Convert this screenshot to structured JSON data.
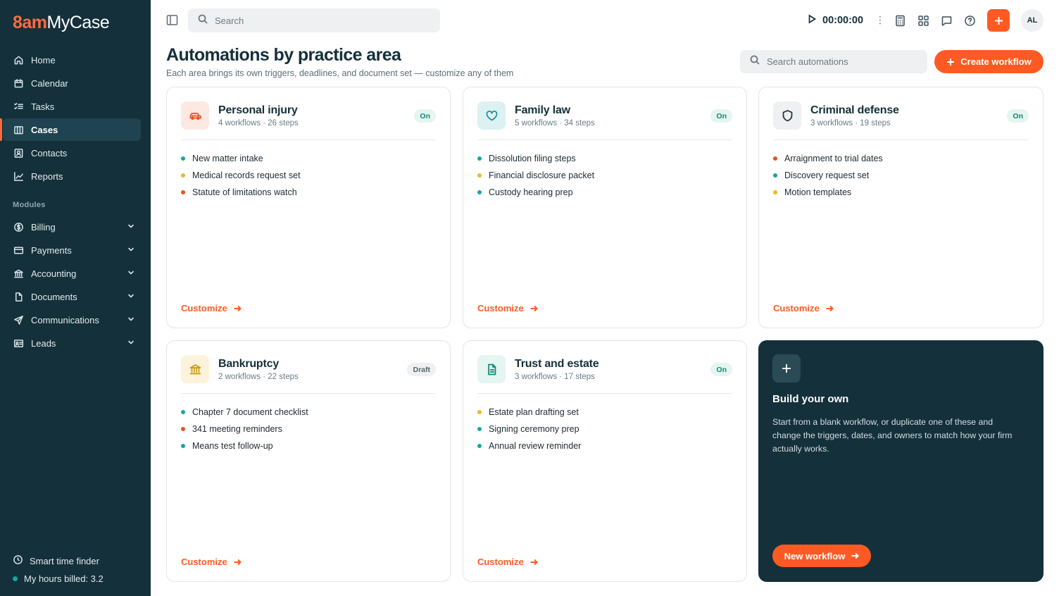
{
  "colors": {
    "accent": "#ff5a23",
    "sidebar": "#14303a",
    "teal": "#1ba3a3",
    "yellow": "#e8b92c",
    "red": "#e2542b"
  },
  "sidebar": {
    "logo_brand": "8am",
    "logo_name": "MyCase",
    "nav": [
      {
        "label": "Home",
        "icon": "home-icon"
      },
      {
        "label": "Calendar",
        "icon": "calendar-icon"
      },
      {
        "label": "Tasks",
        "icon": "tasks-icon"
      },
      {
        "label": "Cases",
        "icon": "cases-icon",
        "active": true
      },
      {
        "label": "Contacts",
        "icon": "contacts-icon"
      },
      {
        "label": "Reports",
        "icon": "reports-icon"
      }
    ],
    "modules_label": "Modules",
    "modules": [
      {
        "label": "Billing",
        "icon": "dollar-icon"
      },
      {
        "label": "Payments",
        "icon": "credit-card-icon"
      },
      {
        "label": "Accounting",
        "icon": "bank-icon"
      },
      {
        "label": "Documents",
        "icon": "document-icon"
      },
      {
        "label": "Communications",
        "icon": "send-icon"
      },
      {
        "label": "Leads",
        "icon": "id-card-icon"
      }
    ],
    "smart_time_finder": "Smart time finder",
    "hours_billed": "My hours billed: 3.2"
  },
  "topbar": {
    "search_placeholder": "Search",
    "timer": "00:00:00",
    "avatar_initials": "AL"
  },
  "header": {
    "title": "Automations by practice area",
    "subtitle": "Each area brings its own triggers, deadlines, and document set — customize any of them",
    "search_placeholder": "Search automations",
    "create_label": "Create workflow"
  },
  "cards": [
    {
      "title": "Personal injury",
      "meta": "4 workflows · 26 steps",
      "status": "On",
      "icon": "car-icon",
      "items": [
        {
          "text": "New matter intake",
          "color": "#1ba3a3"
        },
        {
          "text": "Medical records request set",
          "color": "#e8b92c"
        },
        {
          "text": "Statute of limitations watch",
          "color": "#e2542b"
        }
      ],
      "customize": "Customize"
    },
    {
      "title": "Family law",
      "meta": "5 workflows · 34 steps",
      "status": "On",
      "icon": "heart-icon",
      "items": [
        {
          "text": "Dissolution filing steps",
          "color": "#1ba3a3"
        },
        {
          "text": "Financial disclosure packet",
          "color": "#e8b92c"
        },
        {
          "text": "Custody hearing prep",
          "color": "#1ba3a3"
        }
      ],
      "customize": "Customize"
    },
    {
      "title": "Criminal defense",
      "meta": "3 workflows · 19 steps",
      "status": "On",
      "icon": "shield-icon",
      "items": [
        {
          "text": "Arraignment to trial dates",
          "color": "#e2542b"
        },
        {
          "text": "Discovery request set",
          "color": "#1ba3a3"
        },
        {
          "text": "Motion templates",
          "color": "#e8b92c"
        }
      ],
      "customize": "Customize"
    },
    {
      "title": "Bankruptcy",
      "meta": "2 workflows · 22 steps",
      "status": "Draft",
      "icon": "bank-icon",
      "items": [
        {
          "text": "Chapter 7 document checklist",
          "color": "#1ba3a3"
        },
        {
          "text": "341 meeting reminders",
          "color": "#e2542b"
        },
        {
          "text": "Means test follow-up",
          "color": "#1ba3a3"
        }
      ],
      "customize": "Customize"
    },
    {
      "title": "Trust and estate",
      "meta": "3 workflows · 17 steps",
      "status": "On",
      "icon": "document-icon",
      "items": [
        {
          "text": "Estate plan drafting set",
          "color": "#e8b92c"
        },
        {
          "text": "Signing ceremony prep",
          "color": "#1ba3a3"
        },
        {
          "text": "Annual review reminder",
          "color": "#1ba3a3"
        }
      ],
      "customize": "Customize"
    }
  ],
  "build": {
    "title": "Build your own",
    "description": "Start from a blank workflow, or duplicate one of these and change the triggers, dates, and owners to match how your firm actually works.",
    "button": "New workflow"
  }
}
